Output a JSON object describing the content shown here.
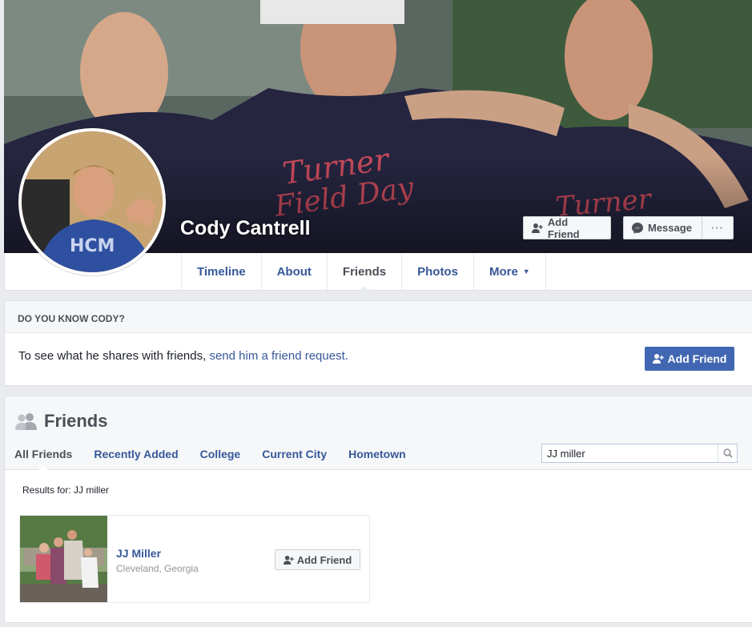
{
  "profile": {
    "name": "Cody Cantrell",
    "cover_buttons": {
      "add_friend": "Add Friend",
      "message": "Message",
      "more": "···"
    },
    "tabs": [
      {
        "label": "Timeline"
      },
      {
        "label": "About"
      },
      {
        "label": "Friends"
      },
      {
        "label": "Photos"
      },
      {
        "label": "More"
      }
    ]
  },
  "know": {
    "heading": "DO YOU KNOW CODY?",
    "text": "To see what he shares with friends, ",
    "link": "send him a friend request.",
    "button": "Add Friend"
  },
  "friends": {
    "title": "Friends",
    "subtabs": [
      {
        "label": "All Friends"
      },
      {
        "label": "Recently Added"
      },
      {
        "label": "College"
      },
      {
        "label": "Current City"
      },
      {
        "label": "Hometown"
      }
    ],
    "search_value": "JJ miller",
    "results_for": "Results for: JJ miller",
    "items": [
      {
        "name": "JJ Miller",
        "location": "Cleveland, Georgia",
        "button": "Add Friend"
      }
    ]
  },
  "colors": {
    "link": "#365899",
    "primary": "#4267b2",
    "background": "#e9ebee"
  },
  "icons": [
    "add-person-icon",
    "messenger-icon",
    "friends-icon",
    "search-icon",
    "caret-down-icon"
  ]
}
